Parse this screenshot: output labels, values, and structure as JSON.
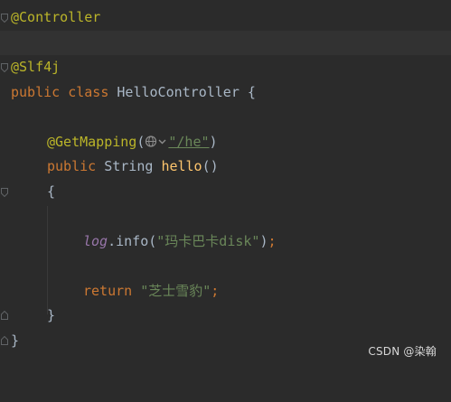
{
  "editor": {
    "lines": {
      "l1": {
        "annotation": "@Controller"
      },
      "l3": {
        "annotation": "@Slf4j"
      },
      "l4": {
        "kw1": "public",
        "kw2": "class",
        "name": "HelloController",
        "brace": "{"
      },
      "l6": {
        "annotation": "@GetMapping",
        "open": "(",
        "string": "\"/he\"",
        "close": ")"
      },
      "l7": {
        "kw1": "public",
        "type": "String",
        "method": "hello",
        "parens": "()"
      },
      "l8": {
        "brace": "{"
      },
      "l10": {
        "field": "log",
        "dot": ".",
        "call": "info",
        "open": "(",
        "string": "\"玛卡巴卡disk\"",
        "close": ")",
        "semi": ";"
      },
      "l12": {
        "kw": "return",
        "string": "\"芝士雪豹\"",
        "semi": ";"
      },
      "l13": {
        "brace": "}"
      },
      "l14": {
        "brace": "}"
      }
    },
    "icons": [
      "globe-icon",
      "chevron-down-icon",
      "fold-marker-icon"
    ]
  },
  "watermark": "CSDN @染翰",
  "colors": {
    "background": "#2b2b2b",
    "annotation": "#bbb529",
    "keyword": "#cc7832",
    "string": "#6a8759",
    "method": "#ffc66d",
    "field": "#9876aa",
    "text": "#a9b7c6"
  }
}
